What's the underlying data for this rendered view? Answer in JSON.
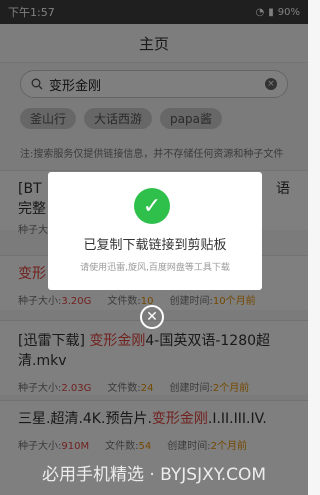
{
  "status": {
    "time": "下午1:57",
    "battery": "90%"
  },
  "header": {
    "title": "主页"
  },
  "search": {
    "value": "变形金刚"
  },
  "tags": [
    "釜山行",
    "大话西游",
    "papa酱"
  ],
  "notice": "注:搜索服务仅提供链接信息，并不存储任何资源和种子文件",
  "items": [
    {
      "pre": "[BT",
      "mid": "",
      "post": "语",
      "line2": "完整",
      "size_label": "种子大",
      "size": "",
      "count_label": "",
      "count": "",
      "time_label": "",
      "time": ""
    },
    {
      "pre": "变形",
      "mid": "",
      "post": "",
      "line2": "",
      "size_label": "种子大小:",
      "size": "3.20G",
      "count_label": "文件数:",
      "count": "10",
      "time_label": "创建时间:",
      "time": "10个月前"
    },
    {
      "pre": "[迅雷下载] ",
      "mid": "变形金刚",
      "post": "4-国英双语-1280超",
      "line2": "清.mkv",
      "size_label": "种子大小:",
      "size": "2.03G",
      "count_label": "文件数:",
      "count": "24",
      "time_label": "创建时间:",
      "time": "2个月前"
    },
    {
      "pre": "三星.超清.4K.预告片.",
      "mid": "变形金刚",
      "post": ".I.II.III.IV.",
      "line2": "",
      "size_label": "种子大小:",
      "size": "910M",
      "count_label": "文件数:",
      "count": "54",
      "time_label": "创建时间:",
      "time": "2个月前"
    }
  ],
  "dialog": {
    "title": "已复制下载链接到剪贴板",
    "subtitle": "请使用迅雷,旋风,百度网盘等工具下载"
  },
  "watermark": "必用手机精选 · BYJSJXY.COM"
}
